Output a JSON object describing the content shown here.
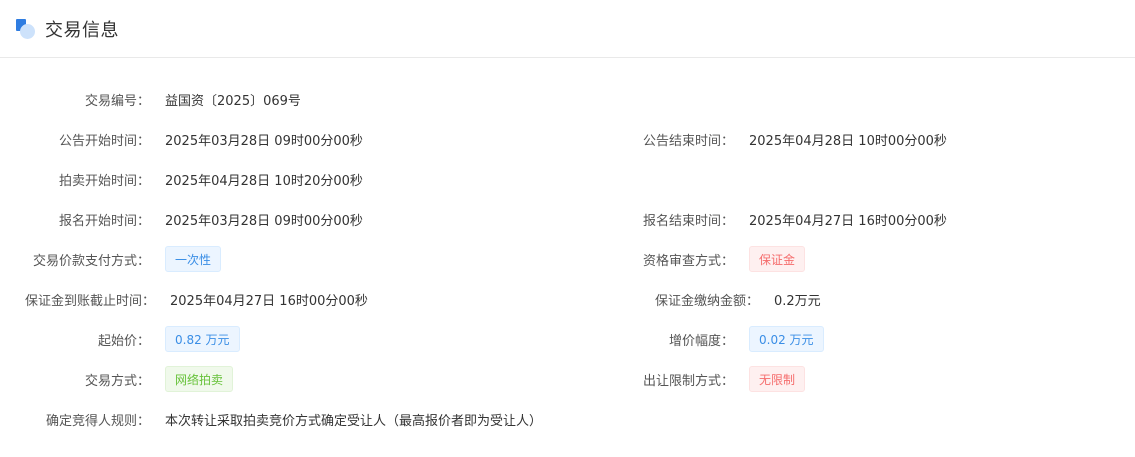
{
  "header": {
    "title": "交易信息"
  },
  "fields": {
    "trade_no": {
      "label": "交易编号：",
      "value": "益国资〔2025〕069号"
    },
    "notice_start": {
      "label": "公告开始时间：",
      "value": "2025年03月28日 09时00分00秒"
    },
    "notice_end": {
      "label": "公告结束时间：",
      "value": "2025年04月28日 10时00分00秒"
    },
    "auction_start": {
      "label": "拍卖开始时间：",
      "value": "2025年04月28日 10时20分00秒"
    },
    "signup_start": {
      "label": "报名开始时间：",
      "value": "2025年03月28日 09时00分00秒"
    },
    "signup_end": {
      "label": "报名结束时间：",
      "value": "2025年04月27日 16时00分00秒"
    },
    "payment_method": {
      "label": "交易价款支付方式：",
      "value": "一次性"
    },
    "qualification_method": {
      "label": "资格审查方式：",
      "value": "保证金"
    },
    "deposit_deadline": {
      "label": "保证金到账截止时间：",
      "value": "2025年04月27日 16时00分00秒"
    },
    "deposit_amount": {
      "label": "保证金缴纳金额：",
      "value": "0.2万元"
    },
    "start_price": {
      "label": "起始价：",
      "value": "0.82 万元"
    },
    "increment": {
      "label": "增价幅度：",
      "value": "0.02 万元"
    },
    "trade_method": {
      "label": "交易方式：",
      "value": "网络拍卖"
    },
    "transfer_limit": {
      "label": "出让限制方式：",
      "value": "无限制"
    },
    "winner_rule": {
      "label": "确定竞得人规则：",
      "value": "本次转让采取拍卖竞价方式确定受让人（最高报价者即为受让人）"
    }
  },
  "colors": {
    "accent": "#2f7de1",
    "tag_blue": "#3a8ee6",
    "tag_red": "#f56c6c",
    "tag_green": "#67c23a"
  }
}
